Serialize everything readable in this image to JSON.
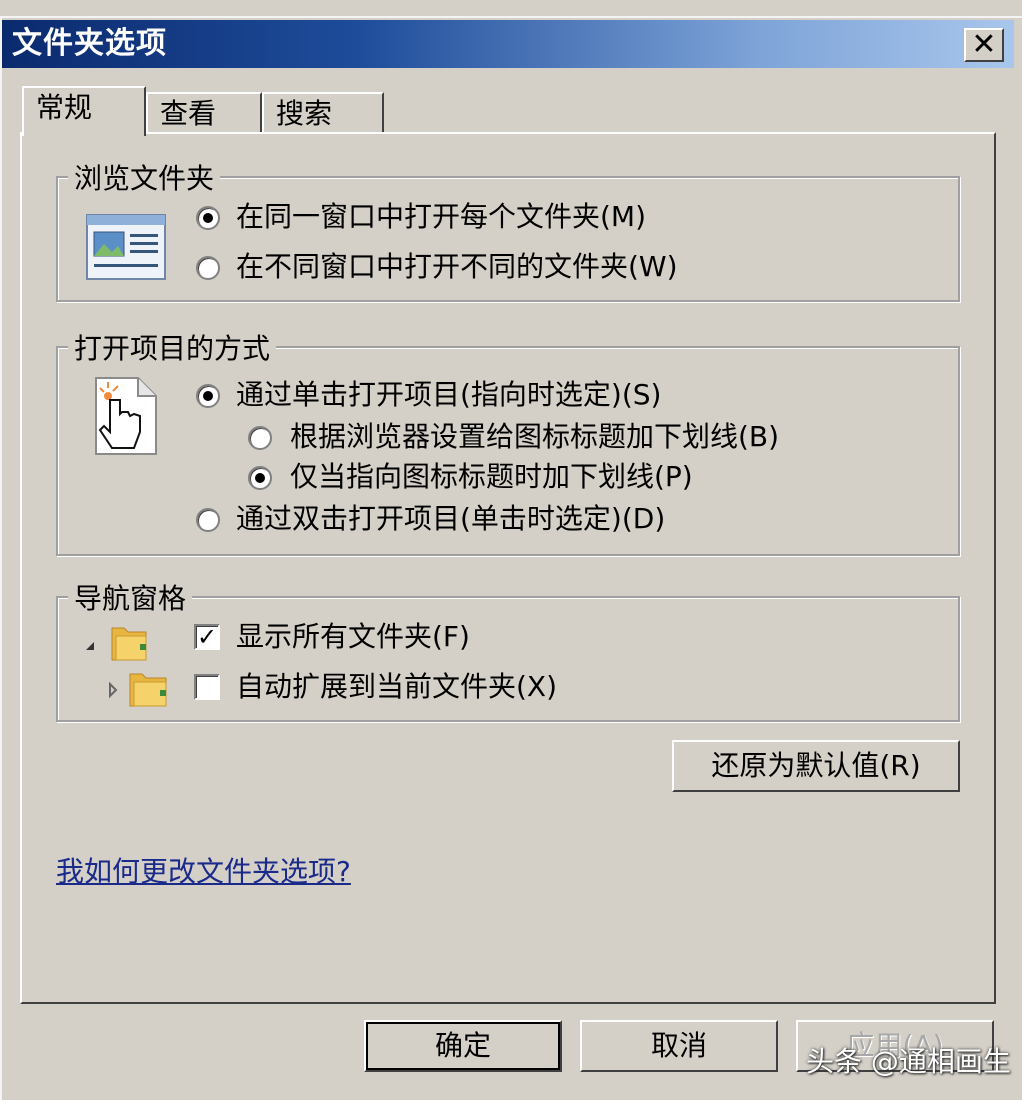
{
  "window": {
    "title": "文件夹选项",
    "close_glyph": "✕"
  },
  "tabs": [
    {
      "label": "常规",
      "selected": true
    },
    {
      "label": "查看",
      "selected": false
    },
    {
      "label": "搜索",
      "selected": false
    }
  ],
  "browse_folders": {
    "legend": "浏览文件夹",
    "options": [
      {
        "label": "在同一窗口中打开每个文件夹(M)",
        "checked": true
      },
      {
        "label": "在不同窗口中打开不同的文件夹(W)",
        "checked": false
      }
    ]
  },
  "click_items": {
    "legend": "打开项目的方式",
    "options": [
      {
        "label": "通过单击打开项目(指向时选定)(S)",
        "checked": true
      },
      {
        "label": "根据浏览器设置给图标标题加下划线(B)",
        "checked": false
      },
      {
        "label": "仅当指向图标标题时加下划线(P)",
        "checked": true
      },
      {
        "label": "通过双击打开项目(单击时选定)(D)",
        "checked": false
      }
    ]
  },
  "navigation_pane": {
    "legend": "导航窗格",
    "options": [
      {
        "label": "显示所有文件夹(F)",
        "checked": true
      },
      {
        "label": "自动扩展到当前文件夹(X)",
        "checked": false
      }
    ]
  },
  "restore_defaults_label": "还原为默认值(R)",
  "help_link": "我如何更改文件夹选项?",
  "buttons": {
    "ok": "确定",
    "cancel": "取消",
    "apply": "应用(A)"
  },
  "watermark": "头条 @通相画生",
  "colors": {
    "title_gradient_start": "#0b2a6e",
    "title_gradient_end": "#a9c6ec",
    "face": "#d4d0c8",
    "link": "#1a2a8a"
  }
}
